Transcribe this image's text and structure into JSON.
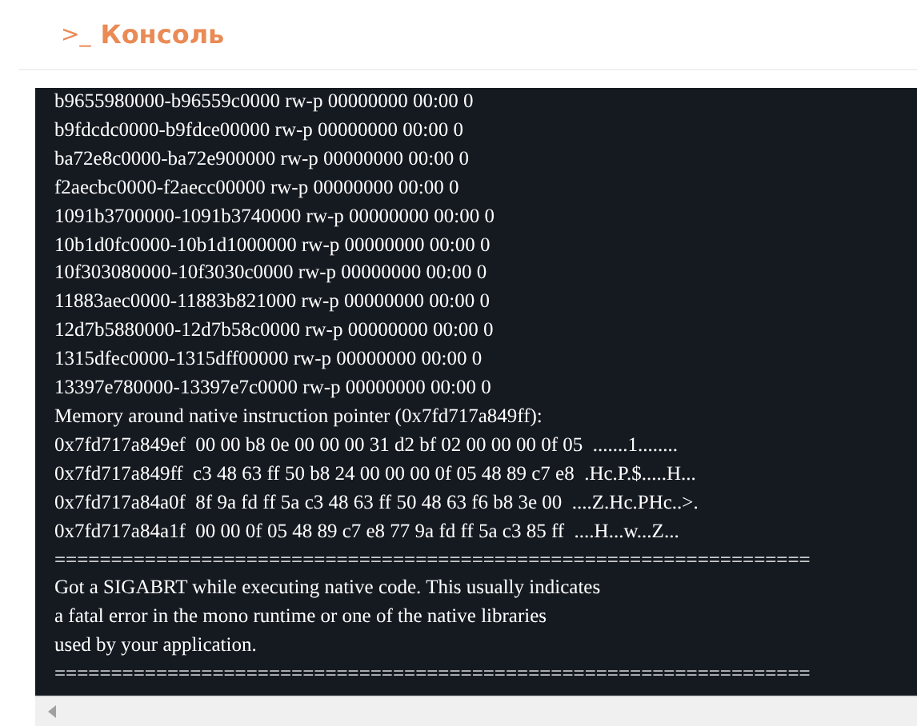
{
  "header": {
    "icon": ">_",
    "title": "Консоль"
  },
  "console": {
    "lines": [
      "b9655980000-b96559c0000 rw-p 00000000 00:00 0",
      "b9fdcdc0000-b9fdce00000 rw-p 00000000 00:00 0",
      "ba72e8c0000-ba72e900000 rw-p 00000000 00:00 0",
      "f2aecbc0000-f2aecc00000 rw-p 00000000 00:00 0",
      "1091b3700000-1091b3740000 rw-p 00000000 00:00 0",
      "10b1d0fc0000-10b1d1000000 rw-p 00000000 00:00 0",
      "10f303080000-10f3030c0000 rw-p 00000000 00:00 0",
      "11883aec0000-11883b821000 rw-p 00000000 00:00 0",
      "12d7b5880000-12d7b58c0000 rw-p 00000000 00:00 0",
      "1315dfec0000-1315dff00000 rw-p 00000000 00:00 0",
      "13397e780000-13397e7c0000 rw-p 00000000 00:00 0",
      "Memory around native instruction pointer (0x7fd717a849ff):",
      "0x7fd717a849ef  00 00 b8 0e 00 00 00 31 d2 bf 02 00 00 00 0f 05  .......1........",
      "0x7fd717a849ff  c3 48 63 ff 50 b8 24 00 00 00 0f 05 48 89 c7 e8  .Hc.P.$.....H...",
      "0x7fd717a84a0f  8f 9a fd ff 5a c3 48 63 ff 50 48 63 f6 b8 3e 00  ....Z.Hc.PHc..>.",
      "0x7fd717a84a1f  00 00 0f 05 48 89 c7 e8 77 9a fd ff 5a c3 85 ff  ....H...w...Z...",
      "===================================================================",
      "Got a SIGABRT while executing native code. This usually indicates",
      "a fatal error in the mono runtime or one of the native libraries",
      "used by your application.",
      "==================================================================="
    ]
  }
}
